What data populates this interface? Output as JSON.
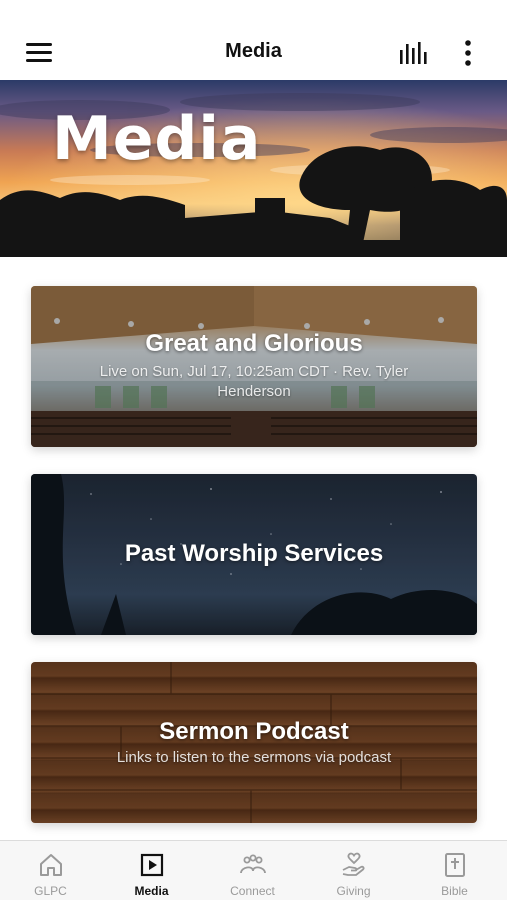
{
  "header": {
    "title": "Media",
    "menu_icon": "hamburger-menu-icon",
    "audio_icon": "audio-bars-icon",
    "more_icon": "more-vertical-icon"
  },
  "hero": {
    "title": "Media"
  },
  "cards": [
    {
      "title": "Great and Glorious",
      "subtitle": "Live on Sun, Jul 17, 10:25am CDT · Rev. Tyler Henderson"
    },
    {
      "title": "Past Worship Services"
    },
    {
      "title": "Sermon Podcast",
      "subtitle": "Links to listen to the sermons via podcast"
    }
  ],
  "bottom_nav": {
    "items": [
      {
        "label": "GLPC",
        "icon": "home-icon",
        "active": false
      },
      {
        "label": "Media",
        "icon": "play-icon",
        "active": true
      },
      {
        "label": "Connect",
        "icon": "people-icon",
        "active": false
      },
      {
        "label": "Giving",
        "icon": "giving-hand-icon",
        "active": false
      },
      {
        "label": "Bible",
        "icon": "bible-icon",
        "active": false
      }
    ]
  },
  "colors": {
    "active_tab": "#111111",
    "inactive_tab": "#9a9a9a",
    "nav_background": "#f7f7f7"
  }
}
